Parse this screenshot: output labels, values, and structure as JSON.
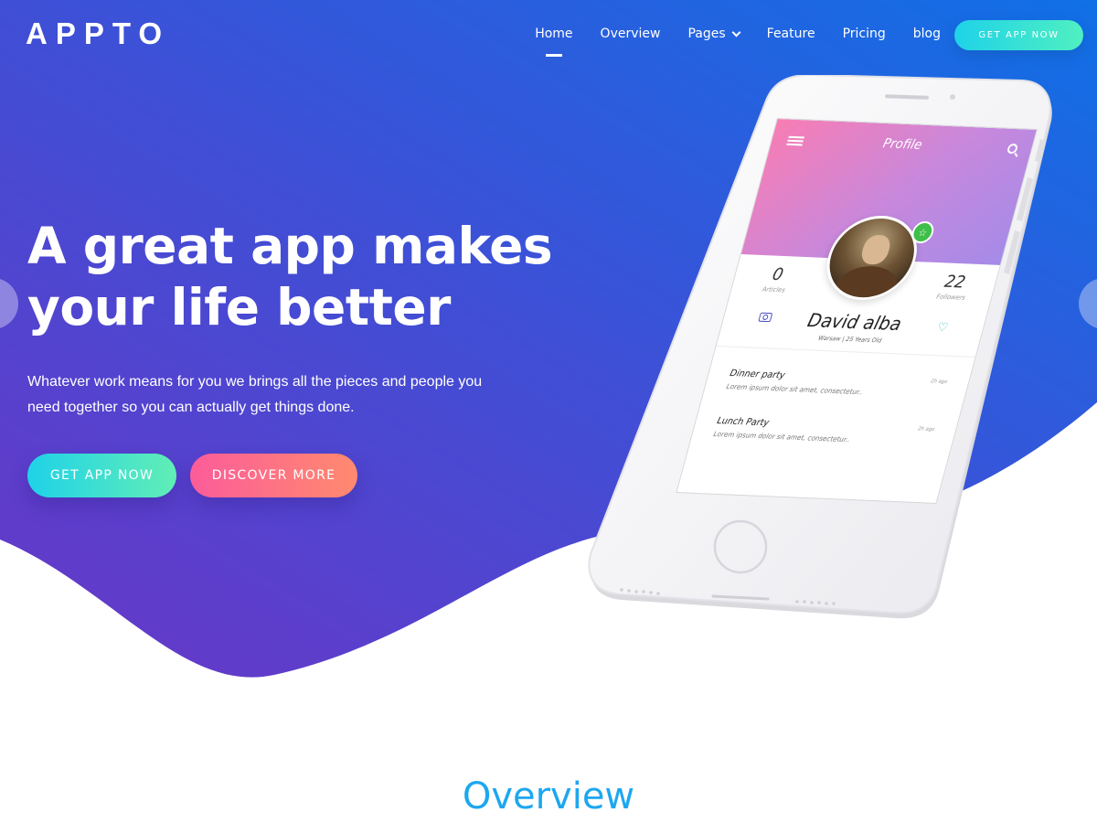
{
  "nav": {
    "logo": "APPTO",
    "items": [
      {
        "label": "Home",
        "active": true
      },
      {
        "label": "Overview"
      },
      {
        "label": "Pages",
        "has_dropdown": true
      },
      {
        "label": "Feature"
      },
      {
        "label": "Pricing"
      },
      {
        "label": "blog"
      }
    ],
    "cta": "GET APP NOW"
  },
  "hero": {
    "title_line1": "A great app makes",
    "title_line2": "your life better",
    "subtitle_line1": "Whatever work means for you we brings all the pieces and people you",
    "subtitle_line2": "need together so you can actually get things done.",
    "primary_button": "GET APP NOW",
    "secondary_button": "DISCOVER MORE"
  },
  "phone_screen": {
    "title": "Profile",
    "stats": [
      {
        "value": "0",
        "label": "Articles"
      },
      {
        "value": "22",
        "label": "Followers"
      }
    ],
    "name": "David alba",
    "location": "Warsaw",
    "age": "25 Years Old",
    "feed": [
      {
        "title": "Dinner party",
        "desc": "Lorem ipsum dolor sit amet, consectetur..",
        "time": "2h ago"
      },
      {
        "title": "Lunch Party",
        "desc": "Lorem ipsum dolor sit amet, consectetur..",
        "time": "2h ago"
      }
    ]
  },
  "overview": {
    "title": "Overview"
  },
  "colors": {
    "hero_gradient_start": "#6a36c6",
    "hero_gradient_end": "#1070e6",
    "cta_gradient_start": "#1fd2e8",
    "cta_gradient_end": "#61eeb6",
    "secondary_gradient_start": "#fc5c9a",
    "secondary_gradient_end": "#ff8a6e",
    "overview_title": "#1da7f0"
  }
}
